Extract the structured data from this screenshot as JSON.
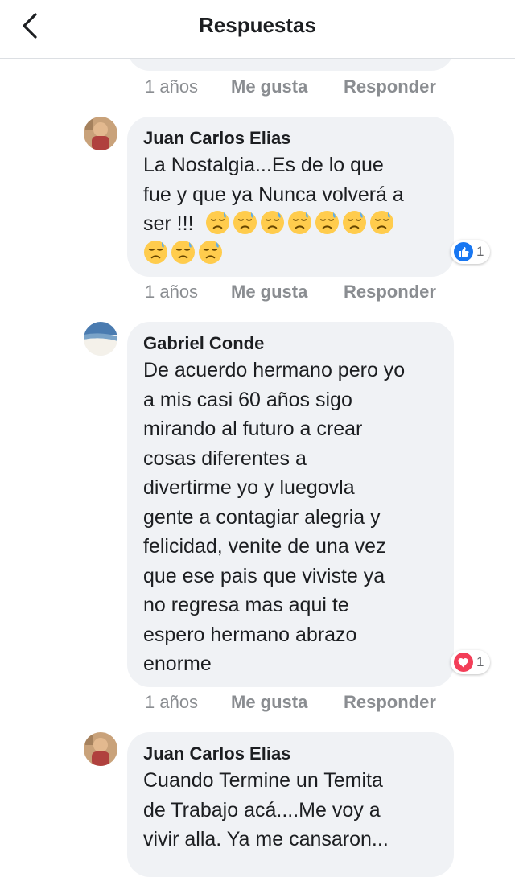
{
  "header": {
    "title": "Respuestas",
    "back_icon": "back-arrow-icon"
  },
  "comments": [
    {
      "actions": {
        "time": "1 años",
        "like": "Me gusta",
        "reply": "Responder"
      }
    },
    {
      "author": "Juan Carlos Elias",
      "text_lines": [
        "La Nostalgia...Es de lo que",
        "fue y que ya Nunca volverá a"
      ],
      "last_line_text": "ser !!!",
      "emoji": "downcast-face-with-sweat-icon",
      "emoji_count_line1": 7,
      "emoji_count_line2": 3,
      "reaction": {
        "icon": "like-icon",
        "count": "1",
        "color": "#1877f2"
      },
      "actions": {
        "time": "1 años",
        "like": "Me gusta",
        "reply": "Responder"
      }
    },
    {
      "author": "Gabriel Conde",
      "text": "De acuerdo hermano pero yo\na mis casi 60 años sigo\nmirando al futuro a crear\ncosas diferentes a\ndivertirme yo y luegovla\ngente a contagiar alegria y\nfelicidad, venite de una vez\nque ese pais que viviste ya\nno regresa mas aqui te\nespero hermano abrazo\nenorme",
      "reaction": {
        "icon": "love-icon",
        "count": "1",
        "color": "#f33e58"
      },
      "actions": {
        "time": "1 años",
        "like": "Me gusta",
        "reply": "Responder"
      }
    },
    {
      "author": "Juan Carlos Elias",
      "text": "Cuando Termine un Temita\nde Trabajo acá....Me voy a\nvivir alla. Ya me cansaron..."
    }
  ]
}
